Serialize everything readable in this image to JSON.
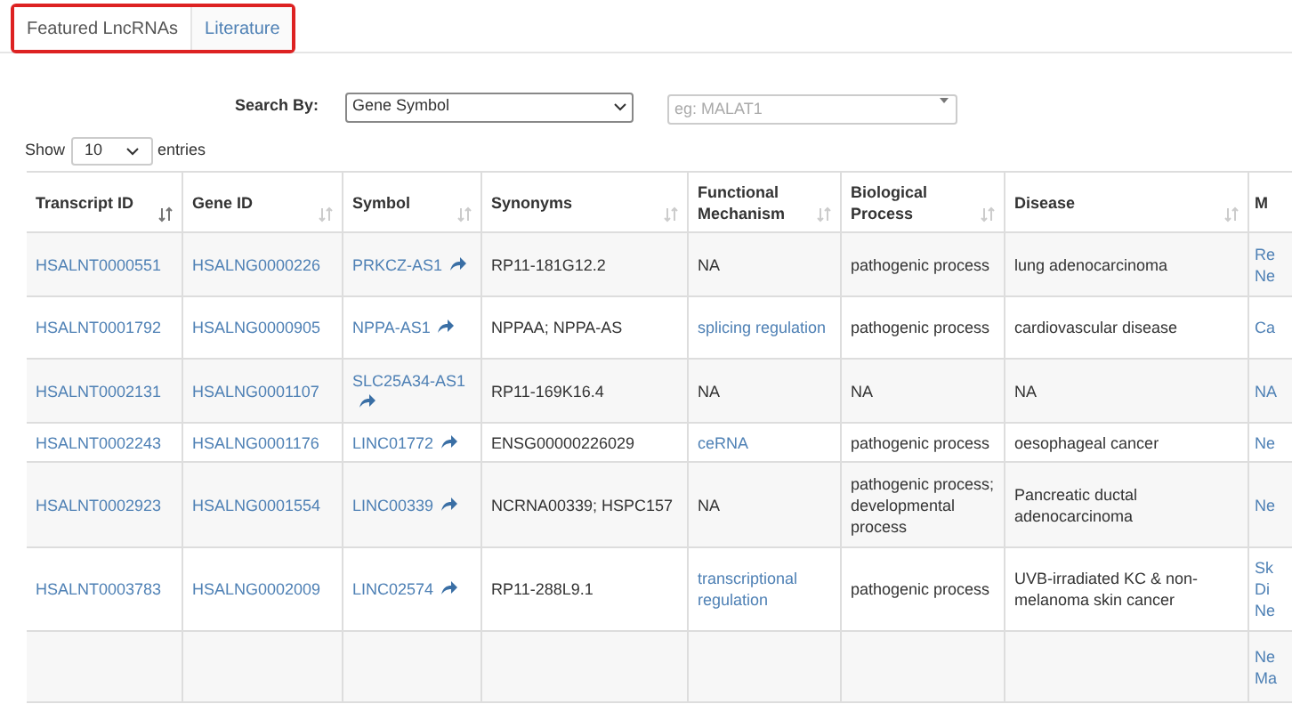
{
  "tabs": [
    {
      "label": "Featured LncRNAs",
      "selected": true
    },
    {
      "label": "Literature",
      "selected": false
    }
  ],
  "search": {
    "label": "Search By:",
    "field": "Gene Symbol",
    "placeholder": "eg: MALAT1"
  },
  "length": {
    "show": "Show",
    "value": "10",
    "entries": "entries"
  },
  "table": {
    "columns": [
      {
        "label": "Transcript ID",
        "sorted": true
      },
      {
        "label": "Gene ID",
        "sorted": false
      },
      {
        "label": "Symbol",
        "sorted": false
      },
      {
        "label": "Synonyms",
        "sorted": false
      },
      {
        "label": "Functional Mechanism",
        "sorted": false
      },
      {
        "label": "Biological Process",
        "sorted": false
      },
      {
        "label": "Disease",
        "sorted": false
      },
      {
        "label": "M"
      }
    ],
    "rows": [
      {
        "transcript_id": "HSALNT0000551",
        "gene_id": "HSALNG0000226",
        "symbol": "PRKCZ-AS1",
        "synonyms": "RP11-181G12.2",
        "mechanism": {
          "text": "NA",
          "kind": "plain"
        },
        "process": "pathogenic process",
        "disease": "lung adenocarcinoma",
        "column_8": "Re Ne"
      },
      {
        "transcript_id": "HSALNT0001792",
        "gene_id": "HSALNG0000905",
        "symbol": "NPPA-AS1",
        "synonyms": "NPPAA; NPPA-AS",
        "mechanism": {
          "text": "splicing regulation",
          "kind": "link"
        },
        "process": "pathogenic process",
        "disease": "cardiovascular disease",
        "column_8": "Ca"
      },
      {
        "transcript_id": "HSALNT0002131",
        "gene_id": "HSALNG0001107",
        "symbol": "SLC25A34-AS1",
        "synonyms": "RP11-169K16.4",
        "mechanism": {
          "text": "NA",
          "kind": "plain"
        },
        "process": "NA",
        "disease": "NA",
        "column_8": "NA"
      },
      {
        "transcript_id": "HSALNT0002243",
        "gene_id": "HSALNG0001176",
        "symbol": "LINC01772",
        "synonyms": "ENSG00000226029",
        "mechanism": {
          "text": "ceRNA",
          "kind": "link"
        },
        "process": "pathogenic process",
        "disease": "oesophageal cancer",
        "column_8": "Ne"
      },
      {
        "transcript_id": "HSALNT0002923",
        "gene_id": "HSALNG0001554",
        "symbol": "LINC00339",
        "synonyms": "NCRNA00339; HSPC157",
        "mechanism": {
          "text": "NA",
          "kind": "plain"
        },
        "process": "pathogenic process; developmental process",
        "disease": "Pancreatic ductal adenocarcinoma",
        "column_8": "Ne"
      },
      {
        "transcript_id": "HSALNT0003783",
        "gene_id": "HSALNG0002009",
        "symbol": "LINC02574",
        "synonyms": "RP11-288L9.1",
        "mechanism": {
          "text": "transcriptional regulation",
          "kind": "link"
        },
        "process": "pathogenic process",
        "disease": "UVB-irradiated KC & non-melanoma skin cancer",
        "column_8": "Sk Di Ne"
      },
      {
        "column_8": "Ne Ma"
      }
    ]
  }
}
